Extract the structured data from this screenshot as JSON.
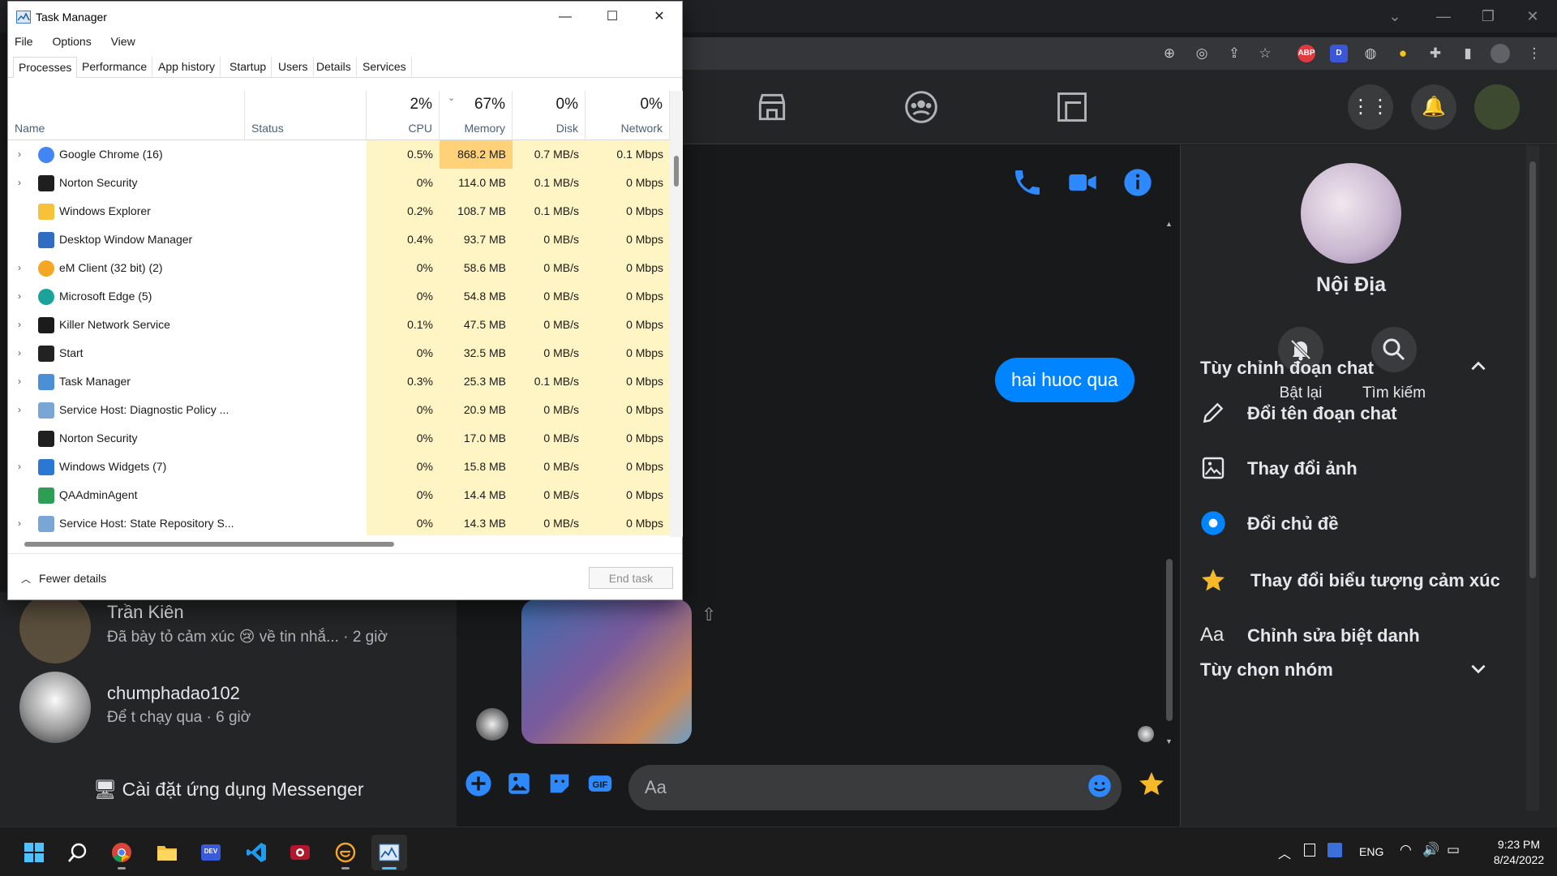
{
  "task_manager": {
    "title": "Task Manager",
    "menu": [
      "File",
      "Options",
      "View"
    ],
    "tabs": [
      "Processes",
      "Performance",
      "App history",
      "Startup",
      "Users",
      "Details",
      "Services"
    ],
    "active_tab": "Processes",
    "columns": {
      "name": "Name",
      "status": "Status",
      "cpu": {
        "pct": "2%",
        "label": "CPU"
      },
      "memory": {
        "pct": "67%",
        "label": "Memory"
      },
      "disk": {
        "pct": "0%",
        "label": "Disk"
      },
      "network": {
        "pct": "0%",
        "label": "Network"
      }
    },
    "processes": [
      {
        "name": "Google Chrome (16)",
        "expandable": true,
        "icon": "chrome-icon",
        "cpu": "0.5%",
        "memory": "868.2 MB",
        "disk": "0.7 MB/s",
        "network": "0.1 Mbps"
      },
      {
        "name": "Norton Security",
        "expandable": true,
        "icon": "norton-icon",
        "cpu": "0%",
        "memory": "114.0 MB",
        "disk": "0.1 MB/s",
        "network": "0 Mbps"
      },
      {
        "name": "Windows Explorer",
        "expandable": false,
        "icon": "folder-icon",
        "cpu": "0.2%",
        "memory": "108.7 MB",
        "disk": "0.1 MB/s",
        "network": "0 Mbps"
      },
      {
        "name": "Desktop Window Manager",
        "expandable": false,
        "icon": "dwm-icon",
        "cpu": "0.4%",
        "memory": "93.7 MB",
        "disk": "0 MB/s",
        "network": "0 Mbps"
      },
      {
        "name": "eM Client (32 bit) (2)",
        "expandable": true,
        "icon": "em-client-icon",
        "cpu": "0%",
        "memory": "58.6 MB",
        "disk": "0 MB/s",
        "network": "0 Mbps"
      },
      {
        "name": "Microsoft Edge (5)",
        "expandable": true,
        "icon": "edge-icon",
        "cpu": "0%",
        "memory": "54.8 MB",
        "disk": "0 MB/s",
        "network": "0 Mbps"
      },
      {
        "name": "Killer Network Service",
        "expandable": true,
        "icon": "killer-icon",
        "cpu": "0.1%",
        "memory": "47.5 MB",
        "disk": "0 MB/s",
        "network": "0 Mbps"
      },
      {
        "name": "Start",
        "expandable": true,
        "icon": "start-icon",
        "cpu": "0%",
        "memory": "32.5 MB",
        "disk": "0 MB/s",
        "network": "0 Mbps"
      },
      {
        "name": "Task Manager",
        "expandable": true,
        "icon": "task-manager-icon",
        "cpu": "0.3%",
        "memory": "25.3 MB",
        "disk": "0.1 MB/s",
        "network": "0 Mbps"
      },
      {
        "name": "Service Host: Diagnostic Policy ...",
        "expandable": true,
        "icon": "service-gear-icon",
        "cpu": "0%",
        "memory": "20.9 MB",
        "disk": "0 MB/s",
        "network": "0 Mbps"
      },
      {
        "name": "Norton Security",
        "expandable": false,
        "icon": "norton-icon",
        "cpu": "0%",
        "memory": "17.0 MB",
        "disk": "0 MB/s",
        "network": "0 Mbps"
      },
      {
        "name": "Windows Widgets (7)",
        "expandable": true,
        "icon": "widgets-icon",
        "cpu": "0%",
        "memory": "15.8 MB",
        "disk": "0 MB/s",
        "network": "0 Mbps"
      },
      {
        "name": "QAAdminAgent",
        "expandable": false,
        "icon": "qa-agent-icon",
        "cpu": "0%",
        "memory": "14.4 MB",
        "disk": "0 MB/s",
        "network": "0 Mbps"
      },
      {
        "name": "Service Host: State Repository S...",
        "expandable": true,
        "icon": "service-gear-icon",
        "cpu": "0%",
        "memory": "14.3 MB",
        "disk": "0 MB/s",
        "network": "0 Mbps"
      }
    ],
    "footer": {
      "fewer_details": "Fewer details",
      "end_task": "End task"
    }
  },
  "chrome": {
    "extensions": [
      "ABP",
      "D"
    ]
  },
  "messenger": {
    "conversations": [
      {
        "name": "Trần Kiên",
        "snippet": "Đã bày tỏ cảm xúc 😢 về tin nhắ... · 2 giờ"
      },
      {
        "name": "chumphadao102",
        "snippet": "Để t chạy qua · 6 giờ"
      }
    ],
    "install_app": "Cài đặt ứng dụng Messenger",
    "sent_message": "hai huoc qua",
    "composer_placeholder": "Aa",
    "info": {
      "name": "Nội Địa",
      "actions": [
        "Bật lại",
        "Tìm kiếm"
      ],
      "section_customize": "Tùy chỉnh đoạn chat",
      "items": [
        "Đổi tên đoạn chat",
        "Thay đổi ảnh",
        "Đổi chủ đề",
        "Thay đổi biểu tượng cảm xúc",
        "Chỉnh sửa biệt danh"
      ],
      "section_group": "Tùy chọn nhóm"
    },
    "accent": "#0084ff"
  },
  "taskbar": {
    "apps": [
      "windows-start-icon",
      "search-icon",
      "chrome-icon",
      "file-explorer-icon",
      "devtoys-icon",
      "vscode-icon",
      "screen-recorder-icon",
      "em-client-icon",
      "task-manager-icon"
    ],
    "language": "ENG",
    "time": "9:23 PM",
    "date": "8/24/2022"
  },
  "colors": {
    "cpu_heat": "#fff4c4",
    "memory_heat": "#ffd27a",
    "messenger_bg": "#18191a",
    "panel_bg": "#242526"
  }
}
